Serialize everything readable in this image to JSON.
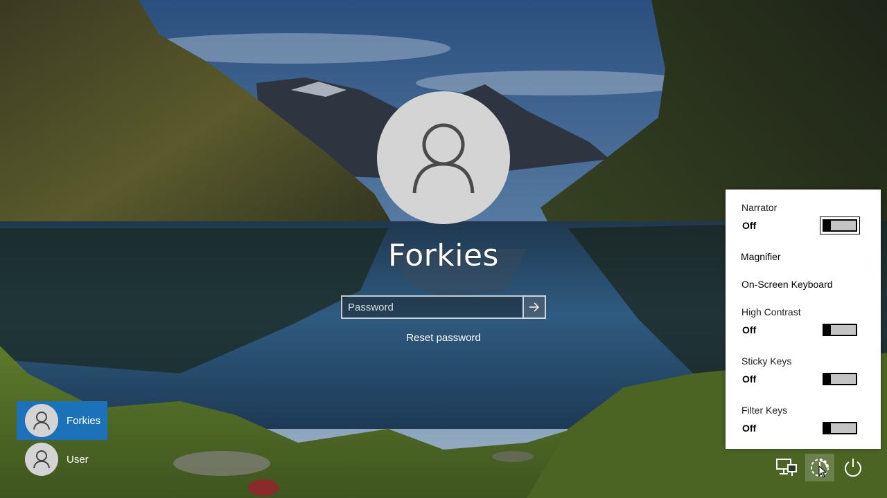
{
  "login": {
    "username": "Forkies",
    "password_placeholder": "Password",
    "reset_password": "Reset password"
  },
  "users": [
    {
      "name": "Forkies",
      "selected": true,
      "icon": "user-icon"
    },
    {
      "name": "User",
      "selected": false,
      "icon": "user-icon"
    }
  ],
  "ease_of_access": {
    "narrator": {
      "label": "Narrator",
      "state": "Off"
    },
    "magnifier": {
      "label": "Magnifier"
    },
    "onscreen_keyboard": {
      "label": "On-Screen Keyboard"
    },
    "high_contrast": {
      "label": "High Contrast",
      "state": "Off"
    },
    "sticky_keys": {
      "label": "Sticky Keys",
      "state": "Off"
    },
    "filter_keys": {
      "label": "Filter Keys",
      "state": "Off"
    }
  },
  "system_buttons": {
    "network": "network-icon",
    "ease_of_access": "ease-of-access-icon",
    "power": "power-icon"
  },
  "colors": {
    "selected_user": "#1b72b8",
    "flyout_bg": "#ffffff",
    "toggle_off": "#c4c4c4"
  }
}
